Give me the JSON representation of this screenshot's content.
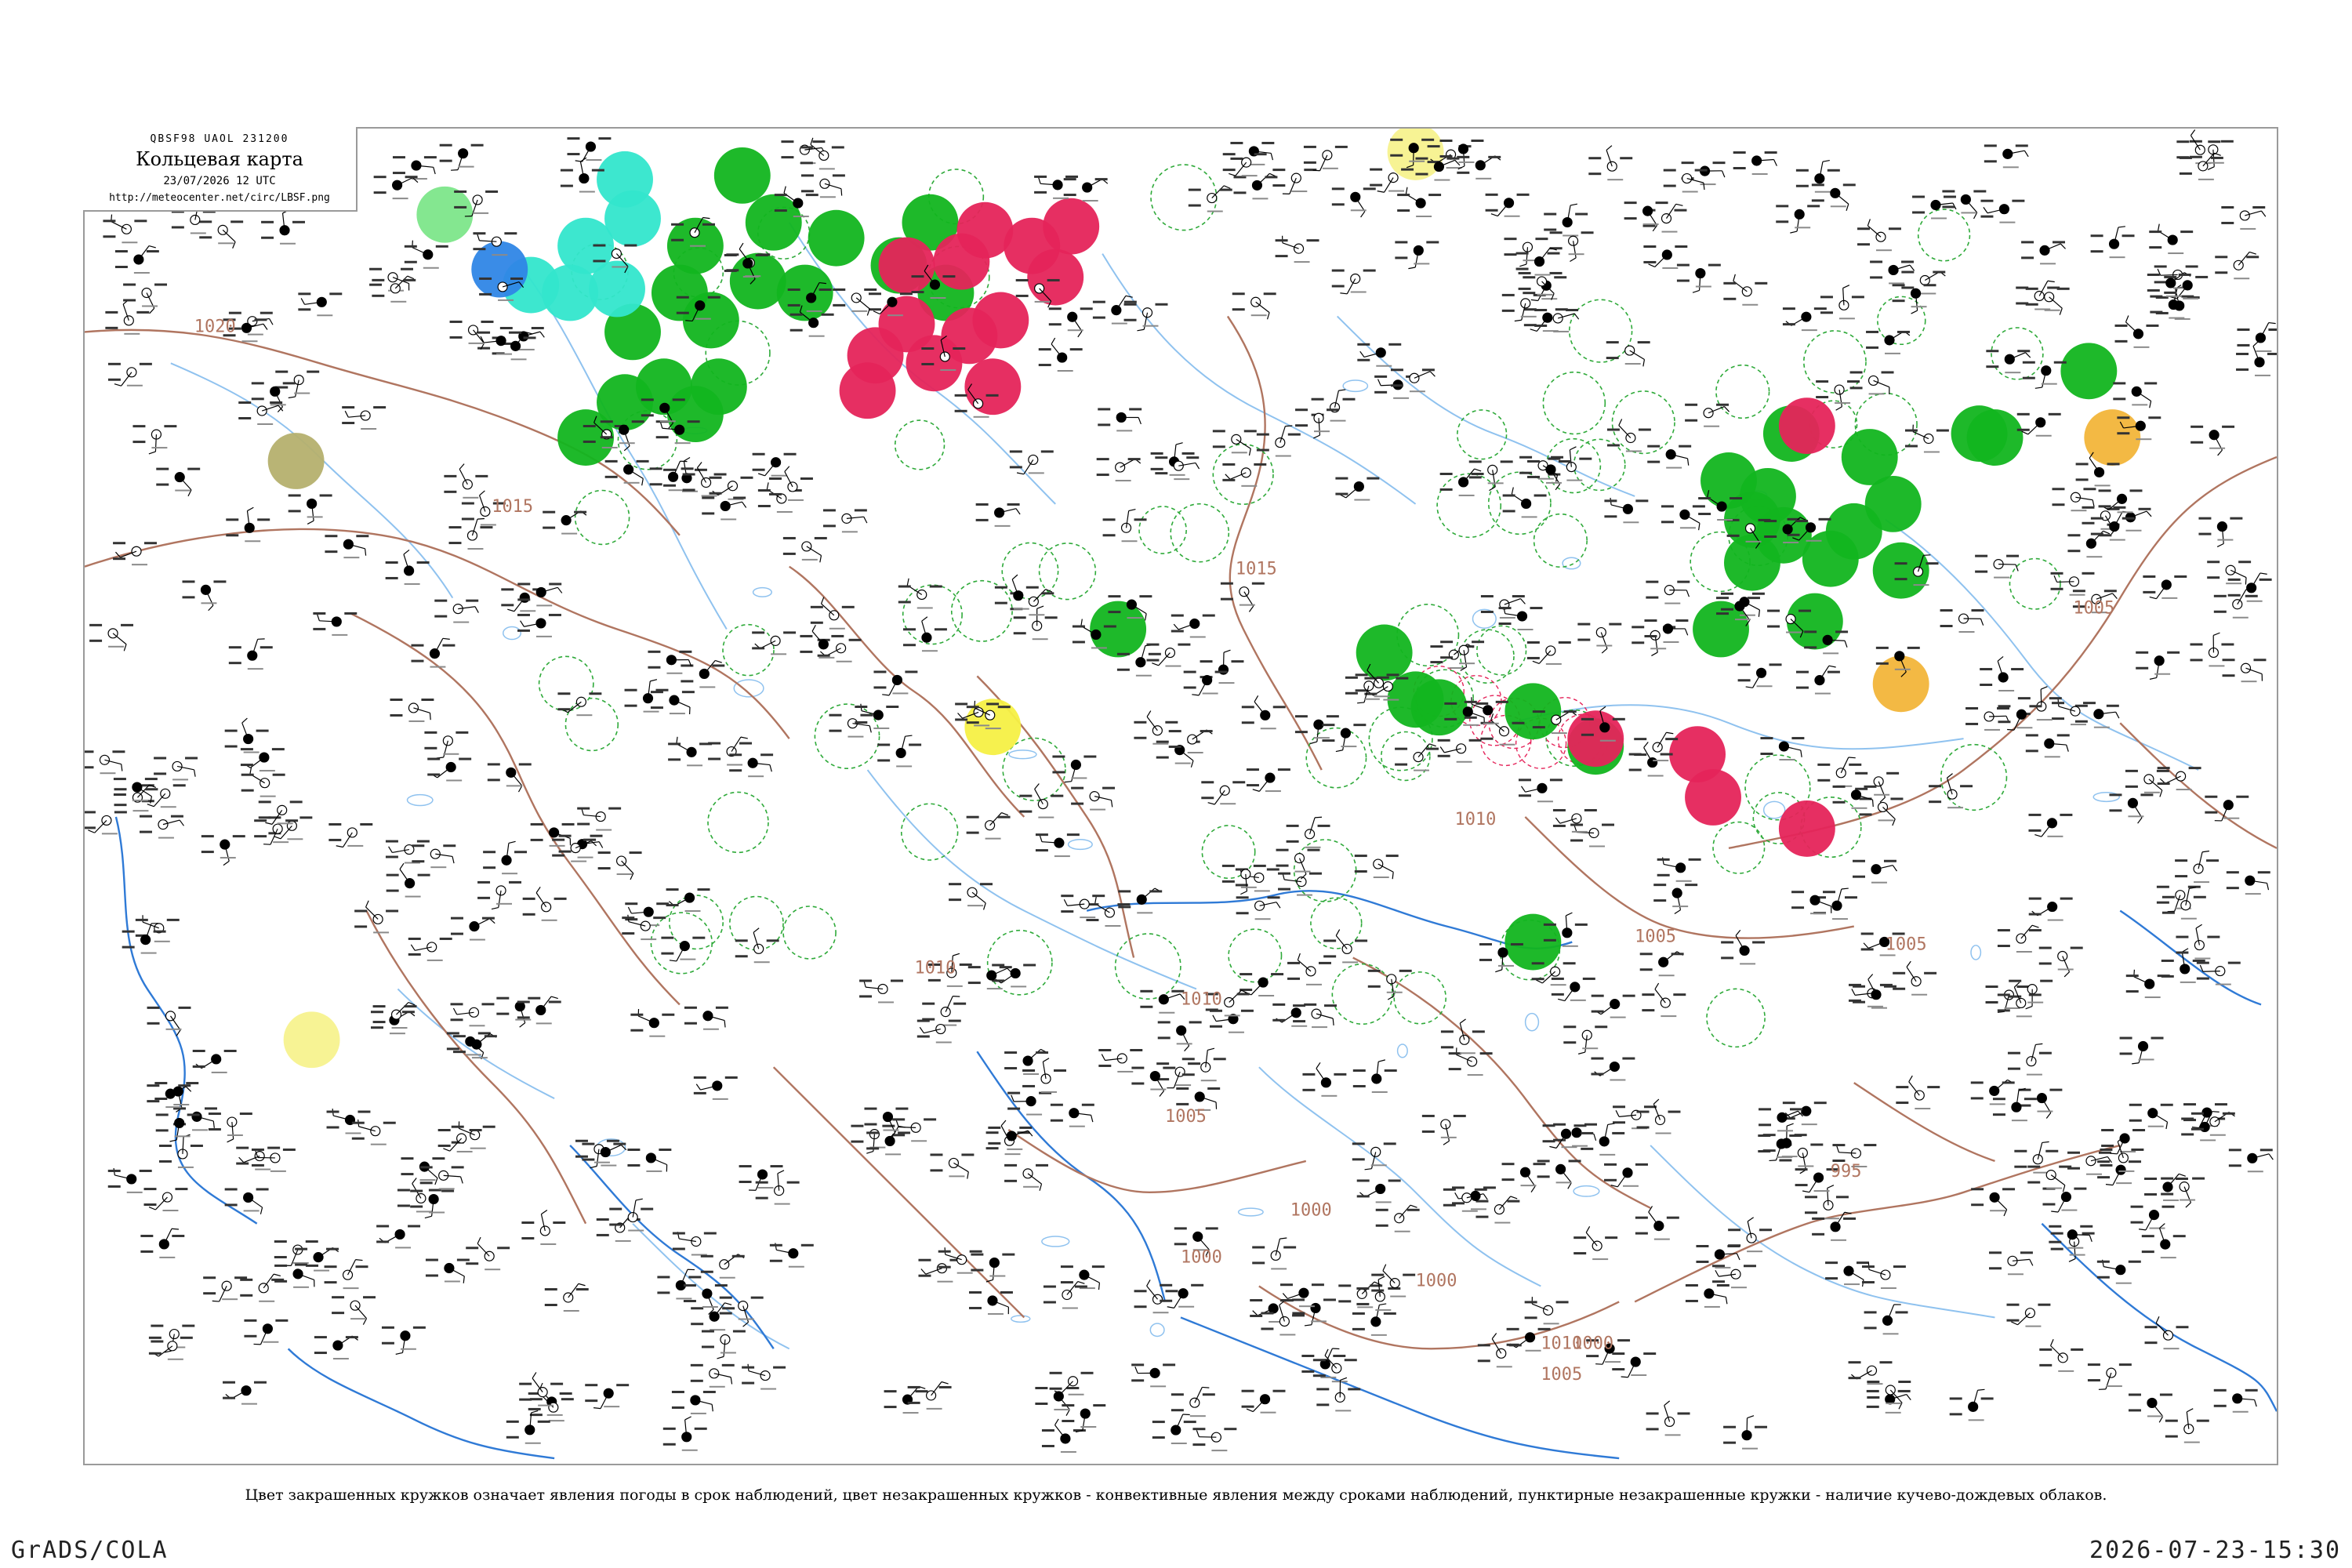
{
  "header": {
    "code": "QBSF98  UAOL  231200",
    "title": "Кольцевая карта",
    "date": "23/07/2026 12 UTC",
    "url": "http://meteocenter.net/circ/LBSF.png"
  },
  "isobars": {
    "color": "#b07560",
    "labels": [
      "1020",
      "1015",
      "1015",
      "1010",
      "1010",
      "1010",
      "1010",
      "1010",
      "1005",
      "1005",
      "1005",
      "1005",
      "1005",
      "1000",
      "1000",
      "1000",
      "1000",
      "995"
    ]
  },
  "phenomena_colors": {
    "green": "#12b51f",
    "red": "#e5245a",
    "cyan": "#33e6cc",
    "light_green": "#7de68a",
    "blue": "#2f86e6",
    "yellow": "#f5f045",
    "pale_yellow": "#f7f28e",
    "orange": "#f2b53a",
    "olive": "#b5b06e"
  },
  "station_groups": [
    {
      "phenomenon": "green",
      "count": 40
    },
    {
      "phenomenon": "red",
      "count": 18
    },
    {
      "phenomenon": "cyan",
      "count": 6
    },
    {
      "phenomenon": "light_green",
      "count": 1
    },
    {
      "phenomenon": "blue",
      "count": 1
    },
    {
      "phenomenon": "yellow",
      "count": 1
    },
    {
      "phenomenon": "pale_yellow",
      "count": 2
    },
    {
      "phenomenon": "orange",
      "count": 2
    },
    {
      "phenomenon": "olive",
      "count": 1
    }
  ],
  "caption": "Цвет закрашенных кружков означает явления погоды в срок наблюдений, цвет незакрашенных кружков - конвективные явления между сроками наблюдений, пунктирные незакрашенные кружки - наличие кучево-дождевых облаков.",
  "footer": {
    "left": "GrADS/COLA",
    "right": "2026-07-23-15:30"
  }
}
